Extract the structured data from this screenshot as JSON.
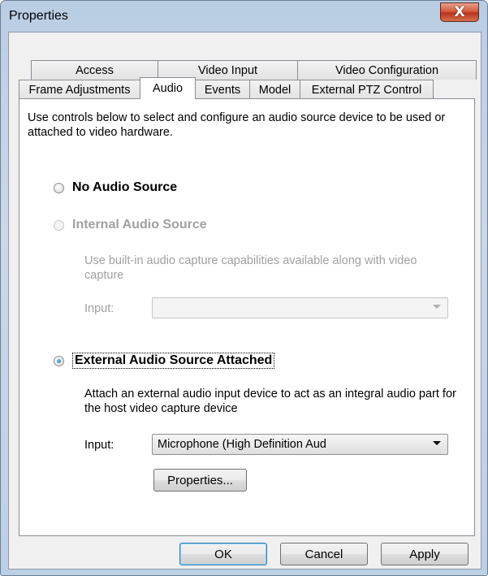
{
  "window": {
    "title": "Properties",
    "close_glyph": "X"
  },
  "tabs": {
    "row1": [
      "Access",
      "Video Input",
      "Video Configuration"
    ],
    "row2": [
      "Frame Adjustments",
      "Audio",
      "Events",
      "Model",
      "External PTZ Control"
    ],
    "active": "Audio"
  },
  "panel": {
    "description": "Use controls below to select and configure an audio source device to be used or attached to video hardware.",
    "no_audio": {
      "label": "No Audio Source",
      "selected": false
    },
    "internal_audio": {
      "label": "Internal Audio Source",
      "enabled": false,
      "description": "Use built-in audio capture capabilities available along with video capture",
      "input_label": "Input:",
      "input_value": ""
    },
    "external_audio": {
      "label": "External Audio Source Attached",
      "selected": true,
      "description": "Attach an external audio input device to act as an integral audio part for the host video capture device",
      "input_label": "Input:",
      "input_value": "Microphone (High Definition Aud",
      "properties_button": "Properties..."
    }
  },
  "buttons": {
    "ok": "OK",
    "cancel": "Cancel",
    "apply": "Apply"
  },
  "colors": {
    "accent": "#3c7fb1",
    "close": "#c8452a"
  }
}
